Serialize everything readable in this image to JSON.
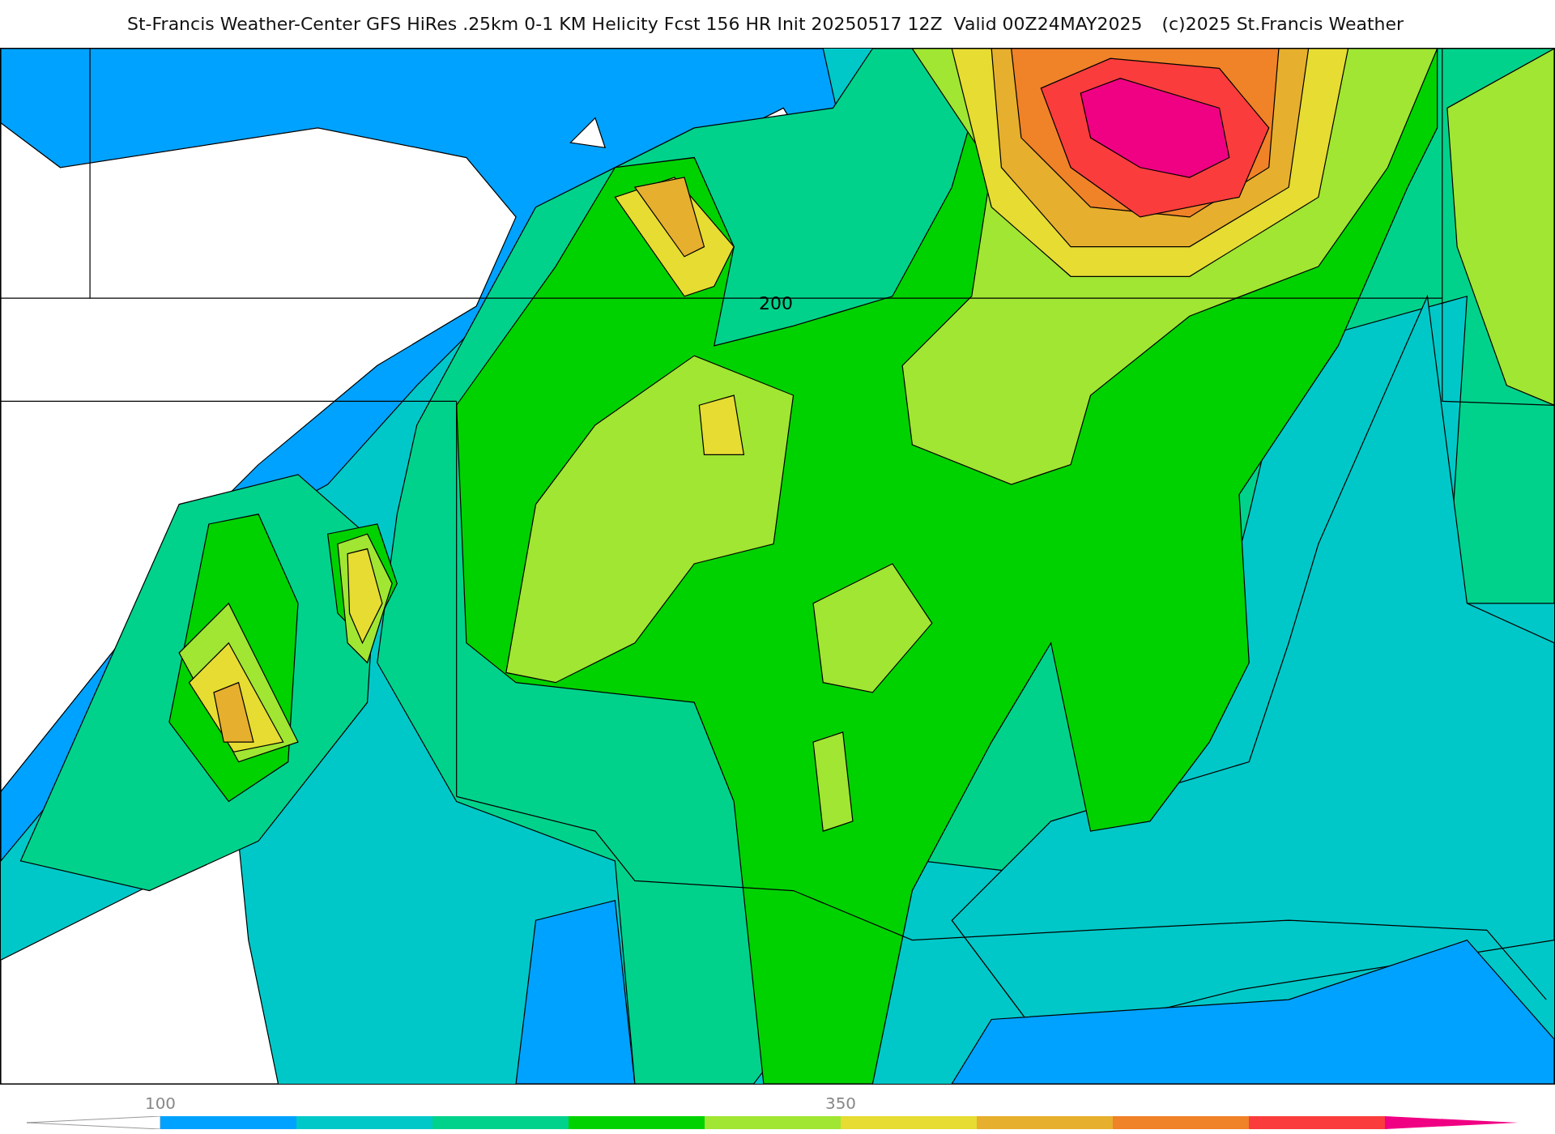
{
  "title": "St-Francis Weather-Center GFS HiRes .25km 0-1 KM Helicity Fcst 156 HR Init 20250517 12Z  Valid 00Z24MAY2025",
  "credit": "(c)2025 St.Francis Weather",
  "map": {
    "contour_label": "200"
  },
  "colorbar": [
    {
      "kind": "start",
      "color": "#ffffff"
    },
    {
      "kind": "band",
      "color": "#00a2ff",
      "tick_label": "100"
    },
    {
      "kind": "band",
      "color": "#00c8c8"
    },
    {
      "kind": "band",
      "color": "#00d28c"
    },
    {
      "kind": "band",
      "color": "#00d200"
    },
    {
      "kind": "band",
      "color": "#a0e632"
    },
    {
      "kind": "band",
      "color": "#e6dc32",
      "tick_label": "350"
    },
    {
      "kind": "band",
      "color": "#e6af2d"
    },
    {
      "kind": "band",
      "color": "#f08228"
    },
    {
      "kind": "band",
      "color": "#fa3c3c"
    },
    {
      "kind": "end",
      "color": "#f00082"
    }
  ]
}
